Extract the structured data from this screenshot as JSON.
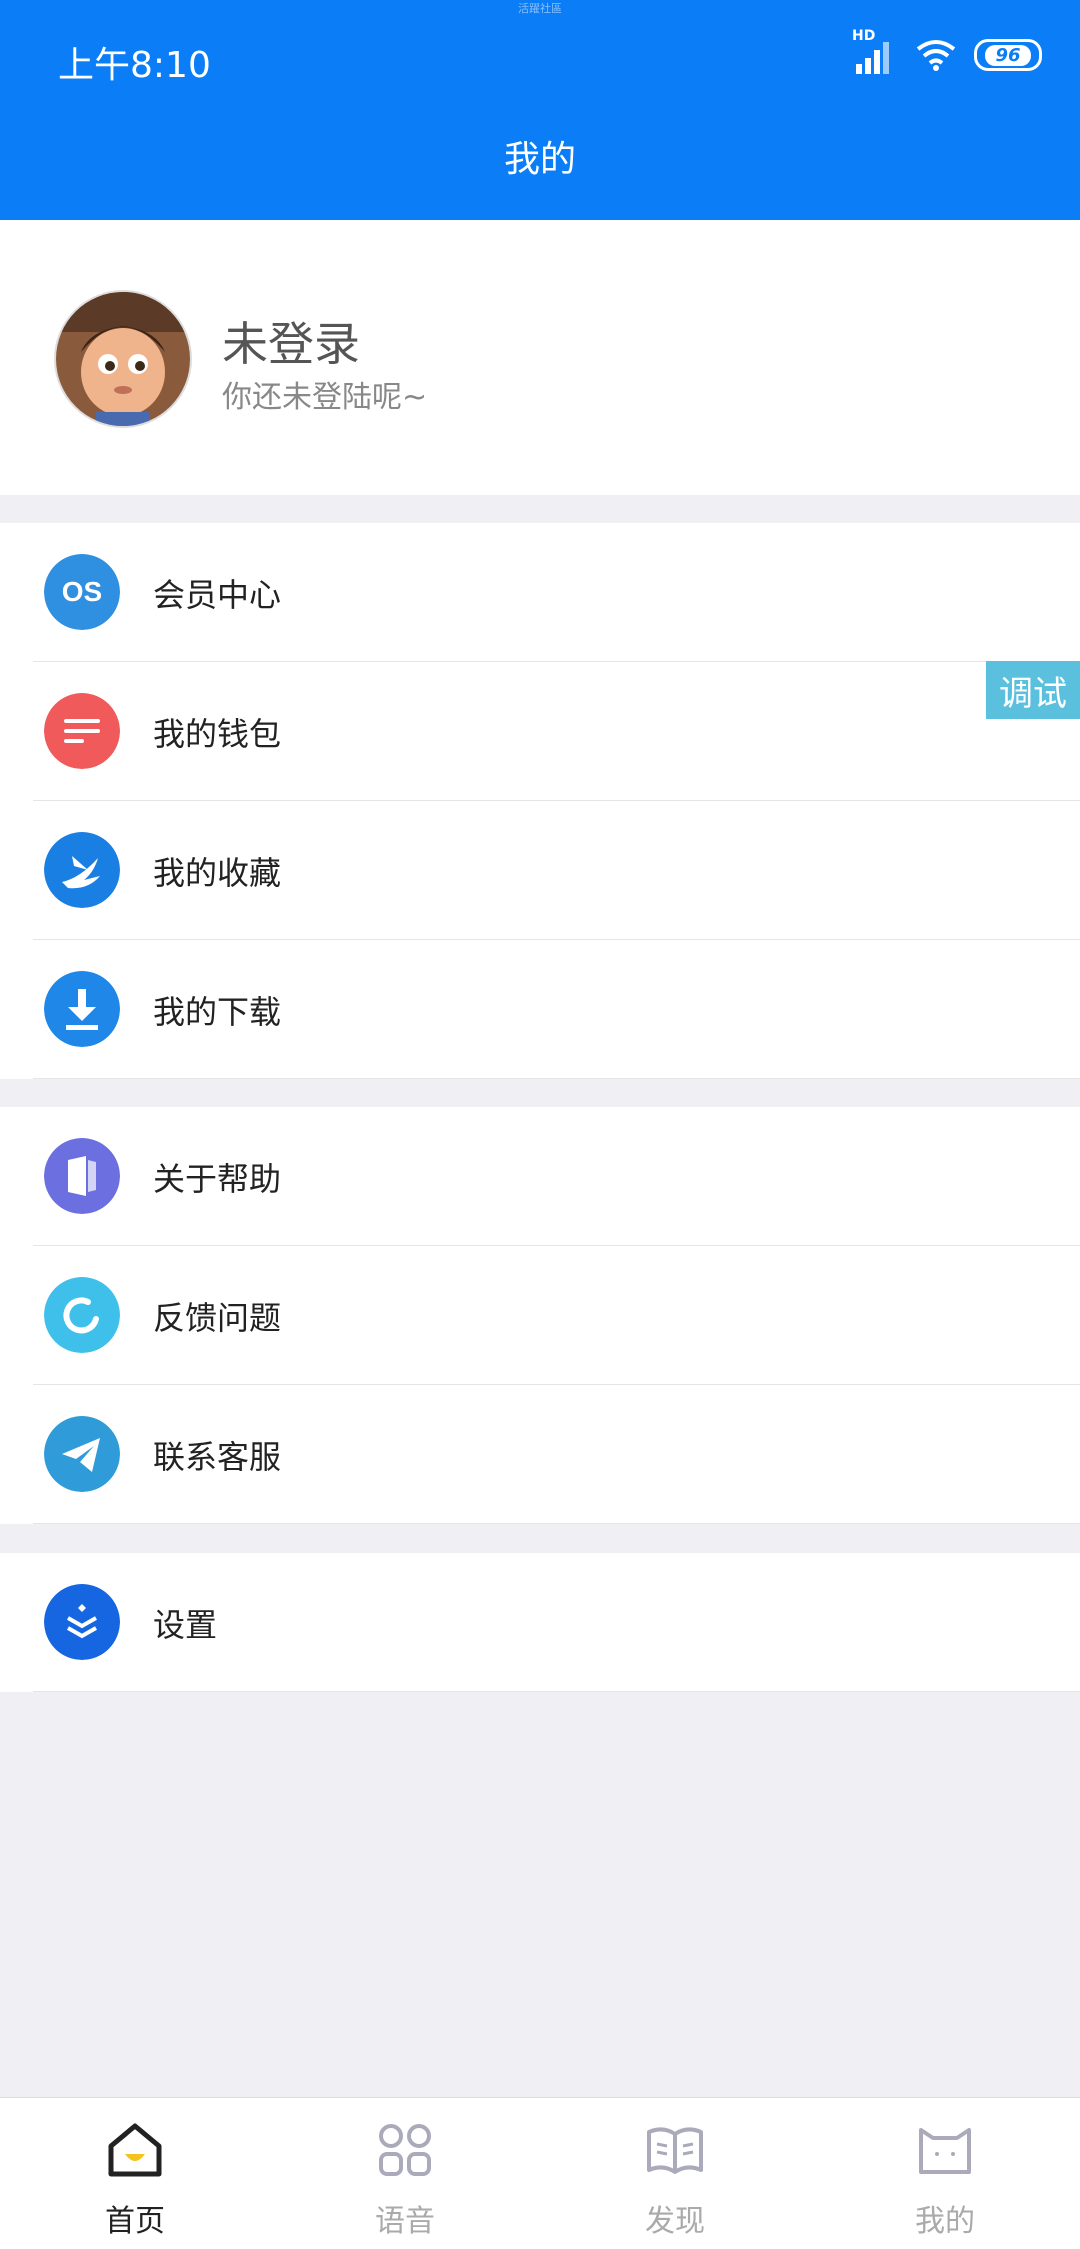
{
  "status_bar": {
    "time": "上午8:10",
    "network": "HD",
    "battery": "96",
    "watermark": "活躍社區"
  },
  "header": {
    "title": "我的"
  },
  "profile": {
    "name": "未登录",
    "subtitle": "你还未登陆呢~"
  },
  "groups": [
    {
      "items": [
        {
          "label": "会员中心",
          "icon": "lastfm-icon",
          "color": "#2f8fe0"
        },
        {
          "label": "我的钱包",
          "icon": "wallet-lines-icon",
          "color": "#f05a5a"
        },
        {
          "label": "我的收藏",
          "icon": "swift-bird-icon",
          "color": "#1a7fe3"
        },
        {
          "label": "我的下载",
          "icon": "download-icon",
          "color": "#1f87e8"
        }
      ]
    },
    {
      "items": [
        {
          "label": "关于帮助",
          "icon": "door-icon",
          "color": "#6b6fe0"
        },
        {
          "label": "反馈问题",
          "icon": "refresh-ring-icon",
          "color": "#3fc0ea"
        },
        {
          "label": "联系客服",
          "icon": "telegram-icon",
          "color": "#2f9bd8"
        }
      ]
    },
    {
      "items": [
        {
          "label": "设置",
          "icon": "layers-icon",
          "color": "#1566e0"
        }
      ]
    }
  ],
  "debug_button": {
    "label": "调试",
    "color": "#5bc0de"
  },
  "tabbar": [
    {
      "label": "首页",
      "icon": "home-icon",
      "active": true
    },
    {
      "label": "语音",
      "icon": "grid-icon",
      "active": false
    },
    {
      "label": "发现",
      "icon": "book-icon",
      "active": false
    },
    {
      "label": "我的",
      "icon": "profile-cat-icon",
      "active": false
    }
  ],
  "colors": {
    "accent": "#0a7df7",
    "background": "#efeff4"
  }
}
